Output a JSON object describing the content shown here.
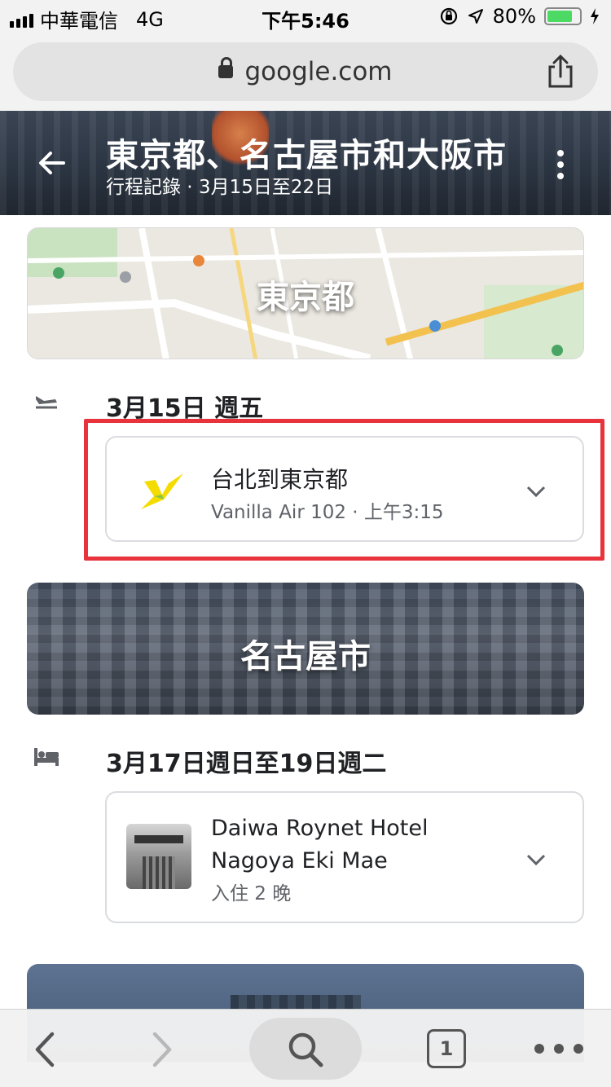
{
  "status_bar": {
    "carrier": "中華電信",
    "network": "4G",
    "time": "下午5:46",
    "battery": "80%",
    "battery_level": 0.8
  },
  "browser": {
    "url": "google.com"
  },
  "trip": {
    "title": "東京都、名古屋市和大阪市",
    "subtitle": "行程記錄 · 3月15日至22日"
  },
  "sections": {
    "tokyo": {
      "city": "東京都",
      "date": "3月15日 週五",
      "flight": {
        "title": "台北到東京都",
        "subtitle": "Vanilla Air 102 · 上午3:15",
        "logo_color": "#f5dc00"
      }
    },
    "nagoya": {
      "city": "名古屋市",
      "date": "3月17日週日至19日週二",
      "hotel": {
        "name": "Daiwa Roynet Hotel Nagoya Eki Mae",
        "stay": "入住 2 晚"
      }
    }
  },
  "toolbar": {
    "tab_count": "1"
  },
  "colors": {
    "highlight": "#e8323c",
    "battery_fill": "#4cd964"
  }
}
